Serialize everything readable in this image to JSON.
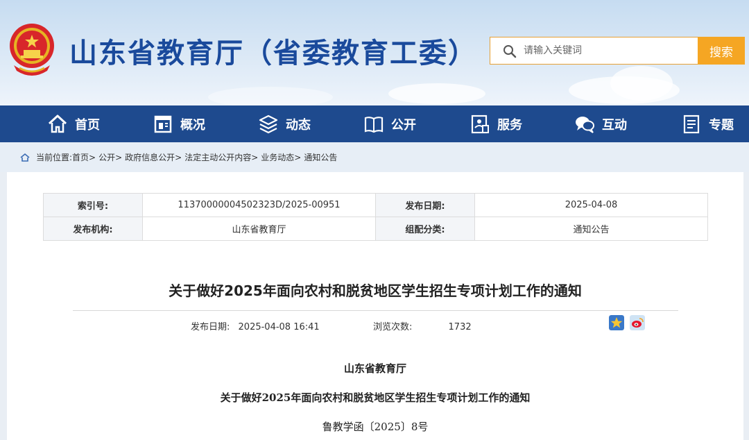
{
  "header": {
    "site_title": "山东省教育厅（省委教育工委）",
    "search_placeholder": "请输入关键词",
    "search_button": "搜索"
  },
  "nav": {
    "items": [
      {
        "label": "首页",
        "icon": "home-icon"
      },
      {
        "label": "概况",
        "icon": "window-icon"
      },
      {
        "label": "动态",
        "icon": "layers-icon"
      },
      {
        "label": "公开",
        "icon": "book-icon"
      },
      {
        "label": "服务",
        "icon": "service-icon"
      },
      {
        "label": "互动",
        "icon": "chat-icon"
      },
      {
        "label": "专题",
        "icon": "document-icon"
      }
    ]
  },
  "breadcrumb": {
    "prefix": "当前位置:",
    "items": [
      "首页>",
      "公开>",
      "政府信息公开>",
      "法定主动公开内容>",
      "业务动态>",
      "通知公告"
    ]
  },
  "meta": {
    "index_label": "索引号:",
    "index_value": "11370000004502323D/2025-00951",
    "date_label": "发布日期:",
    "date_value": "2025-04-08",
    "org_label": "发布机构:",
    "org_value": "山东省教育厅",
    "category_label": "组配分类:",
    "category_value": "通知公告"
  },
  "article": {
    "title": "关于做好2025年面向农村和脱贫地区学生招生专项计划工作的通知",
    "publish_label": "发布日期:",
    "publish_value": "2025-04-08 16:41",
    "views_label": "浏览次数:",
    "views_value": "1732",
    "issuer": "山东省教育厅",
    "subtitle": "关于做好2025年面向农村和脱贫地区学生招生专项计划工作的通知",
    "doc_number": "鲁教学函〔2025〕8号"
  },
  "colors": {
    "nav_bg": "#1e4a8e",
    "title_blue": "#1a4a9c",
    "search_orange": "#f5a623"
  }
}
